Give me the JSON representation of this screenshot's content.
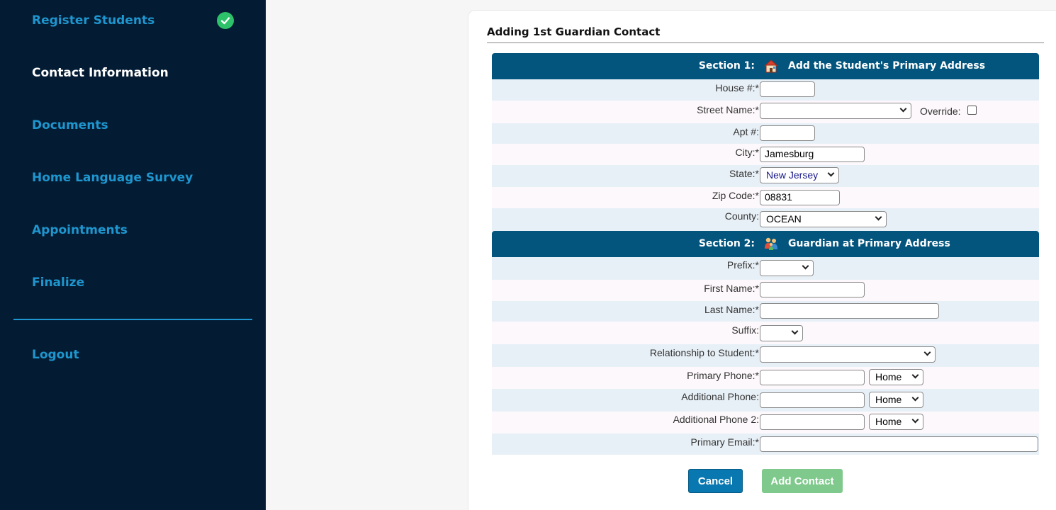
{
  "sidebar": {
    "items": [
      {
        "label": "Register Students",
        "completed": true
      },
      {
        "label": "Contact Information",
        "active": true
      },
      {
        "label": "Documents"
      },
      {
        "label": "Home Language Survey"
      },
      {
        "label": "Appointments"
      },
      {
        "label": "Finalize"
      }
    ],
    "logout_label": "Logout"
  },
  "page": {
    "title": "Adding 1st Guardian Contact"
  },
  "section1": {
    "number": "Section 1:",
    "icon": "house-icon",
    "title": "Add the Student's Primary Address",
    "fields": {
      "house": {
        "label": "House #:*",
        "value": ""
      },
      "street": {
        "label": "Street Name:*",
        "value": ""
      },
      "override": {
        "label": "Override:",
        "checked": false
      },
      "apt": {
        "label": "Apt #:",
        "value": ""
      },
      "city": {
        "label": "City:*",
        "value": "Jamesburg"
      },
      "state": {
        "label": "State:*",
        "value": "New Jersey"
      },
      "zip": {
        "label": "Zip Code:*",
        "value": "08831"
      },
      "county": {
        "label": "County:",
        "value": "OCEAN"
      }
    }
  },
  "section2": {
    "number": "Section 2:",
    "icon": "family-icon",
    "title": "Guardian at Primary Address",
    "fields": {
      "prefix": {
        "label": "Prefix:*",
        "value": ""
      },
      "first_name": {
        "label": "First Name:*",
        "value": ""
      },
      "last_name": {
        "label": "Last Name:*",
        "value": ""
      },
      "suffix": {
        "label": "Suffix:",
        "value": ""
      },
      "relationship": {
        "label": "Relationship to Student:*",
        "value": ""
      },
      "primary_phone": {
        "label": "Primary Phone:*",
        "value": "",
        "type": "Home"
      },
      "additional_phone": {
        "label": "Additional Phone:",
        "value": "",
        "type": "Home"
      },
      "additional_phone2": {
        "label": "Additional Phone 2:",
        "value": "",
        "type": "Home"
      },
      "primary_email": {
        "label": "Primary Email:*",
        "value": ""
      }
    }
  },
  "buttons": {
    "cancel": "Cancel",
    "add": "Add Contact"
  },
  "colors": {
    "sidebar_bg": "#041c33",
    "link": "#1e96cf",
    "section_header": "#04557e",
    "check": "#2dc26a",
    "cancel_btn": "#0a78b0",
    "add_btn": "#7fc98c"
  }
}
